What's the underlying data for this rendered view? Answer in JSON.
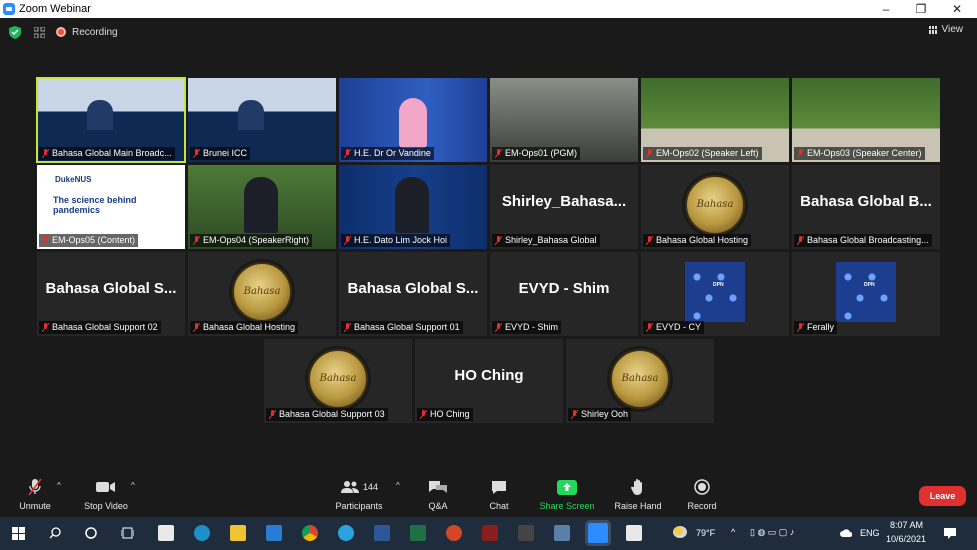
{
  "window": {
    "title": "Zoom Webinar",
    "min": "–",
    "max": "❐",
    "close": "✕"
  },
  "top": {
    "recording": "Recording",
    "view": "View"
  },
  "tiles": [
    {
      "label": "Bahasa Global Main Broadc..."
    },
    {
      "label": "Brunei ICC"
    },
    {
      "label": "H.E. Dr Or Vandine"
    },
    {
      "label": "EM-Ops01 (PGM)"
    },
    {
      "label": "EM-Ops02 (Speaker Left)"
    },
    {
      "label": "EM-Ops03 (Speaker Center)"
    },
    {
      "label": "EM-Ops05 (Content)",
      "slide_title": "The science behind pandemics",
      "slide_brand": "DukeNUS"
    },
    {
      "label": "EM-Ops04 (SpeakerRight)"
    },
    {
      "label": "H.E. Dato Lim Jock Hoi"
    },
    {
      "label": "Shirley_Bahasa Global",
      "big": "Shirley_Bahasa..."
    },
    {
      "label": "Bahasa Global Hosting",
      "logo": "Bahasa"
    },
    {
      "label": "Bahasa Global Broadcasting...",
      "big": "Bahasa Global B..."
    },
    {
      "label": "Bahasa Global Support 02",
      "big": "Bahasa Global S..."
    },
    {
      "label": "Bahasa Global Hosting",
      "logo": "Bahasa"
    },
    {
      "label": "Bahasa Global Support 01",
      "big": "Bahasa Global S..."
    },
    {
      "label": "EVYD - Shim",
      "big": "EVYD - Shim"
    },
    {
      "label": "EVYD - CY",
      "dpn": "DPN"
    },
    {
      "label": "Ferally",
      "dpn": "DPN"
    },
    {
      "label": "Bahasa Global Support 03",
      "logo": "Bahasa"
    },
    {
      "label": "HO Ching",
      "big": "HO Ching"
    },
    {
      "label": "Shirley Ooh",
      "logo": "Bahasa"
    }
  ],
  "toolbar": {
    "unmute": "Unmute",
    "stop_video": "Stop Video",
    "participants": "Participants",
    "participants_count": "144",
    "qa": "Q&A",
    "chat": "Chat",
    "share": "Share Screen",
    "raise": "Raise Hand",
    "record": "Record",
    "leave": "Leave"
  },
  "taskbar": {
    "temp": "79°F",
    "lang": "ENG",
    "time": "8:07 AM",
    "date": "10/6/2021"
  },
  "colors": {
    "accent_green": "#c6e53a",
    "share_green": "#23d959",
    "leave_red": "#e0302f",
    "zoom_blue": "#2d8cff"
  }
}
